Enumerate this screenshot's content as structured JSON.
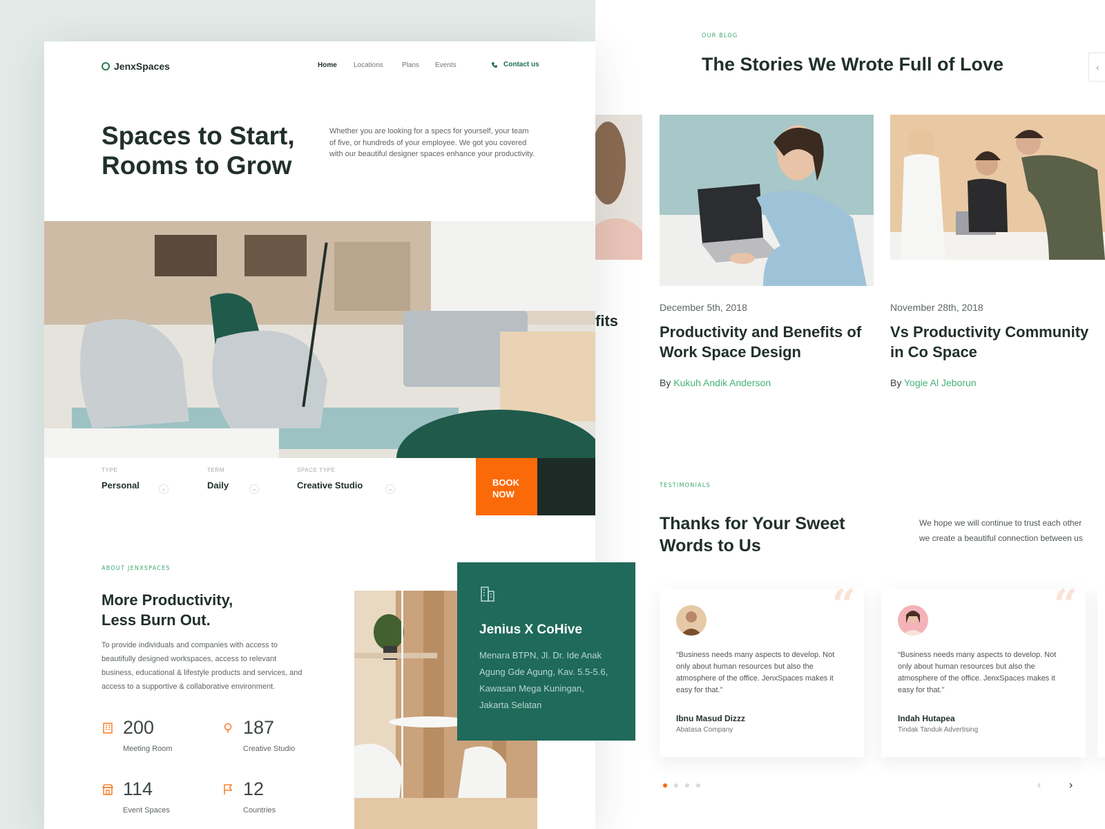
{
  "brand": {
    "name": "JenxSpaces",
    "accent": "#2b7a55",
    "orange": "#fb6a08",
    "dark_green": "#1f6a5b"
  },
  "nav": {
    "items": [
      "Home",
      "Locations",
      "Plans",
      "Events"
    ],
    "active": "Home",
    "contact_label": "Contact us"
  },
  "hero": {
    "title_line1": "Spaces to Start,",
    "title_line2": "Rooms to Grow",
    "description": "Whether you are looking for a specs for yourself, your team of five, or hundreds of your employee. We got you covered with our beautiful designer spaces enhance your productivity."
  },
  "booking": {
    "fields": [
      {
        "label": "TYPE",
        "value": "Personal"
      },
      {
        "label": "TERM",
        "value": "Daily"
      },
      {
        "label": "SPACE TYPE",
        "value": "Creative Studio"
      }
    ],
    "book_line1": "BOOK",
    "book_line2": "NOW"
  },
  "about": {
    "kicker": "ABOUT JENXSPACES",
    "title_line1": "More Productivity,",
    "title_line2": "Less Burn Out.",
    "description": "To provide individuals and companies with access to beautifully designed workspaces, access to relevant business, educational & lifestyle products and services, and access to a supportive & collaborative environment.",
    "stats": [
      {
        "value": "200",
        "label": "Meeting Room",
        "icon": "building-icon"
      },
      {
        "value": "187",
        "label": "Creative Studio",
        "icon": "lightbulb-icon"
      },
      {
        "value": "114",
        "label": "Event Spaces",
        "icon": "store-icon"
      },
      {
        "value": "12",
        "label": "Countries",
        "icon": "flag-icon"
      }
    ]
  },
  "location_card": {
    "title": "Jenius X CoHive",
    "address": "Menara BTPN, Jl. Dr. Ide Anak Agung Gde Agung, Kav. 5.5-5.6, Kawasan Mega Kuningan, Jakarta Selatan",
    "icon": "office-building-icon"
  },
  "blog": {
    "kicker": "OUR BLOG",
    "title": "The Stories We Wrote Full of Love",
    "partial_title_fragment": "fits",
    "posts": [
      {
        "date": "December 5th, 2018",
        "title": "Productivity and Benefits of Work Space Design",
        "by": "By",
        "author": "Kukuh Andik Anderson"
      },
      {
        "date": "November 28th, 2018",
        "title": "Vs Productivity Community in Co Space",
        "by": "By",
        "author": "Yogie Al Jeborun"
      }
    ]
  },
  "testimonials": {
    "kicker": "TESTIMONIALS",
    "title_line1": "Thanks for Your Sweet",
    "title_line2": "Words to Us",
    "intro_line1": "We hope we will continue to trust each other",
    "intro_line2": "we create a beautiful connection between us",
    "items": [
      {
        "quote": "“Business needs many aspects to develop. Not only about human resources but also the atmosphere of the office. JenxSpaces makes it easy for that.”",
        "name": "Ibnu Masud Dizzz",
        "company": "Abatasa Company"
      },
      {
        "quote": "“Business needs many aspects to develop. Not only about human resources but also the atmosphere of the office. JenxSpaces makes it easy for that.”",
        "name": "Indah Hutapea",
        "company": "Tindak Tanduk Advertising"
      }
    ],
    "pagination": {
      "total": 4,
      "active": 1
    }
  }
}
